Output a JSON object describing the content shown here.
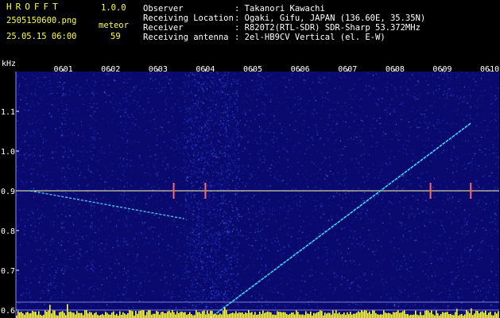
{
  "header": {
    "app_title": "HROFFT",
    "version": "1.0.0",
    "filename": "2505150600.png",
    "datetime": "25.05.15 06:00",
    "count_label": "meteor",
    "count_value": "59",
    "info": [
      {
        "label": "Observer",
        "value": ": Takanori Kawachi"
      },
      {
        "label": "Receiving Location",
        "value": ": Ogaki, Gifu, JAPAN (136.60E, 35.35N)"
      },
      {
        "label": "Receiver",
        "value": ": R820T2(RTL-SDR) SDR-Sharp 53.372MHz"
      },
      {
        "label": "Receiving antenna",
        "value": ": 2el-HB9CV Vertical (el. E-W)"
      }
    ]
  },
  "chart_data": {
    "type": "heatmap",
    "ylabel": "kHz",
    "ylim": [
      0.58,
      1.2
    ],
    "xlim": [
      0,
      10.2
    ],
    "x_ticks": [
      "0601",
      "0602",
      "0603",
      "0604",
      "0605",
      "0606",
      "0607",
      "0608",
      "0609",
      "0610"
    ],
    "y_ticks": [
      "1.1",
      "1.0",
      "0.9",
      "0.8",
      "0.7",
      "0.6"
    ],
    "y_tick_values": [
      1.1,
      1.0,
      0.9,
      0.8,
      0.7,
      0.6
    ],
    "carrier_khz": 0.9,
    "ref_lines_khz": [
      0.62,
      0.6
    ],
    "colors": {
      "background": "#0a0a6e",
      "carrier": "#ffffaa",
      "trace": "#44e8ff",
      "spectrum": "#ffff33",
      "axis_text": "#ffffff",
      "bright_band": "#3c5cff"
    }
  }
}
